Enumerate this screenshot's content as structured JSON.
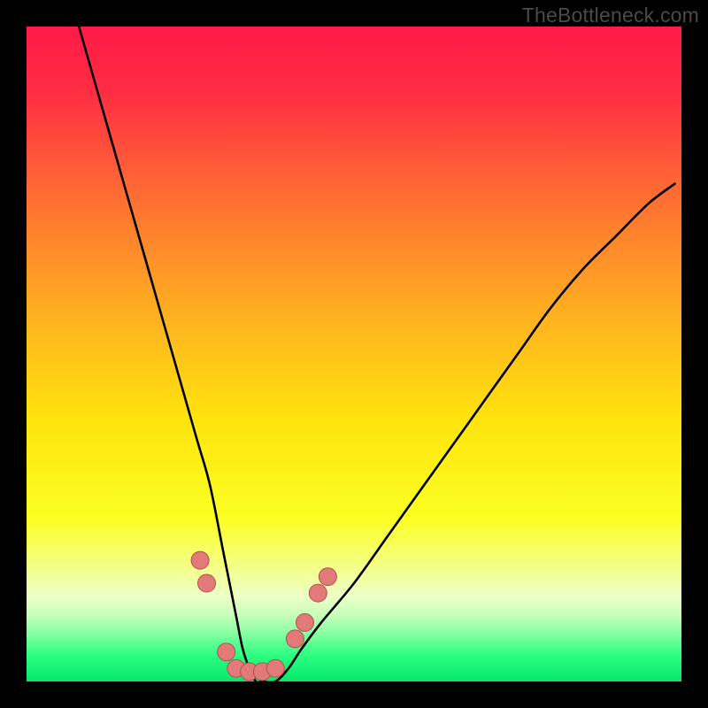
{
  "watermark": "TheBottleneck.com",
  "chart_data": {
    "type": "line",
    "title": "",
    "xlabel": "",
    "ylabel": "",
    "xlim": [
      0,
      100
    ],
    "ylim": [
      0,
      100
    ],
    "background_gradient": {
      "stops": [
        {
          "pos": 0.0,
          "color": "#ff1a47"
        },
        {
          "pos": 0.1,
          "color": "#ff2d43"
        },
        {
          "pos": 0.25,
          "color": "#ff6a34"
        },
        {
          "pos": 0.45,
          "color": "#ffb41f"
        },
        {
          "pos": 0.6,
          "color": "#ffe40e"
        },
        {
          "pos": 0.75,
          "color": "#fbff22"
        },
        {
          "pos": 0.83,
          "color": "#f3ff8e"
        },
        {
          "pos": 0.87,
          "color": "#edffc8"
        },
        {
          "pos": 0.9,
          "color": "#c6ffb8"
        },
        {
          "pos": 0.93,
          "color": "#7dff9e"
        },
        {
          "pos": 0.96,
          "color": "#2cff82"
        },
        {
          "pos": 1.0,
          "color": "#07e768"
        }
      ]
    },
    "series": [
      {
        "name": "bottleneck-curve",
        "x": [
          8,
          10,
          12,
          14,
          16,
          18,
          20,
          22,
          24,
          26,
          28,
          30,
          31,
          32,
          33,
          34,
          35,
          36,
          38,
          40,
          42,
          45,
          50,
          55,
          60,
          65,
          70,
          75,
          80,
          85,
          90,
          95,
          99
        ],
        "y": [
          100,
          93,
          86,
          79,
          72,
          65,
          58,
          51,
          44,
          37,
          30,
          20,
          15,
          10,
          5,
          2,
          0,
          0,
          0,
          2,
          5,
          9,
          15,
          22,
          29,
          36,
          43,
          50,
          57,
          63,
          68,
          73,
          76
        ]
      }
    ],
    "markers": [
      {
        "name": "point-left-1",
        "x": 26.5,
        "y": 18.5
      },
      {
        "name": "point-left-2",
        "x": 27.5,
        "y": 15.0
      },
      {
        "name": "point-trough-1",
        "x": 30.5,
        "y": 4.5
      },
      {
        "name": "point-trough-2",
        "x": 32.0,
        "y": 2.0
      },
      {
        "name": "point-trough-3",
        "x": 34.0,
        "y": 1.5
      },
      {
        "name": "point-trough-4",
        "x": 36.0,
        "y": 1.5
      },
      {
        "name": "point-trough-5",
        "x": 38.0,
        "y": 2.0
      },
      {
        "name": "point-right-1",
        "x": 41.0,
        "y": 6.5
      },
      {
        "name": "point-right-2",
        "x": 42.5,
        "y": 9.0
      },
      {
        "name": "point-right-3",
        "x": 44.5,
        "y": 13.5
      },
      {
        "name": "point-right-4",
        "x": 46.0,
        "y": 16.0
      }
    ],
    "marker_style": {
      "fill": "#e27a7a",
      "stroke": "#b54e4e",
      "r": 10
    },
    "curve_style": {
      "stroke": "#000000",
      "width": 2.6
    }
  }
}
